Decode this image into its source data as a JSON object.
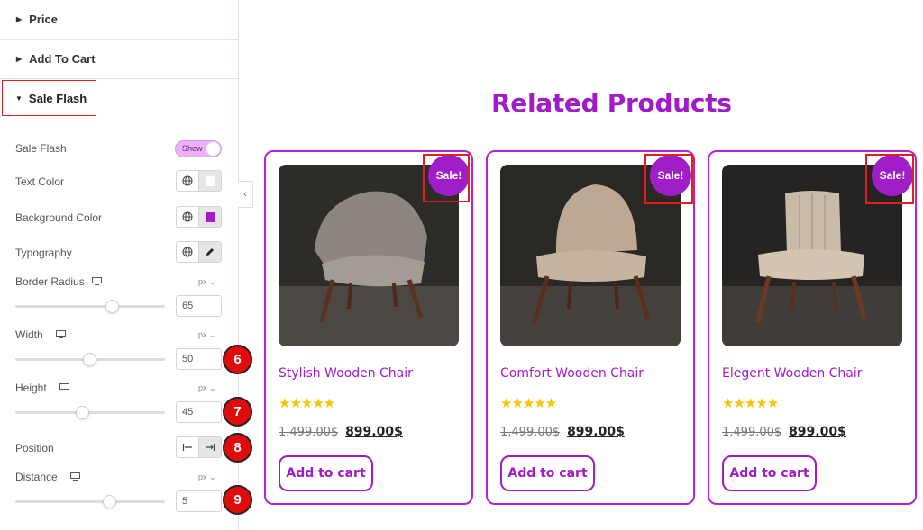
{
  "panel": {
    "sections": {
      "price": "Price",
      "add_to_cart": "Add To Cart",
      "sale_flash": "Sale Flash"
    },
    "controls": {
      "sale_flash_label": "Sale Flash",
      "sale_flash_toggle": "Show",
      "text_color_label": "Text Color",
      "text_color_value": "#ffffff",
      "background_color_label": "Background Color",
      "background_color_value": "#a01ec8",
      "typography_label": "Typography",
      "border_radius_label": "Border Radius",
      "border_radius_unit": "px",
      "border_radius_value": "65",
      "width_label": "Width",
      "width_unit": "px",
      "width_value": "50",
      "height_label": "Height",
      "height_unit": "px",
      "height_value": "45",
      "position_label": "Position",
      "position_options": [
        "left",
        "right"
      ],
      "position_selected": "right",
      "distance_label": "Distance",
      "distance_unit": "px",
      "distance_value": "5"
    },
    "markers": [
      "6",
      "7",
      "8",
      "9"
    ]
  },
  "main": {
    "heading": "Related Products",
    "products": [
      {
        "name": "Stylish Wooden Chair",
        "badge": "Sale!",
        "stars": "★★★★★",
        "old_price": "1,499.00$",
        "new_price": "899.00$",
        "button": "Add to cart"
      },
      {
        "name": "Comfort Wooden Chair",
        "badge": "Sale!",
        "stars": "★★★★★",
        "old_price": "1,499.00$",
        "new_price": "899.00$",
        "button": "Add to cart"
      },
      {
        "name": "Elegent Wooden Chair",
        "badge": "Sale!",
        "stars": "★★★★★",
        "old_price": "1,499.00$",
        "new_price": "899.00$",
        "button": "Add to cart"
      }
    ]
  },
  "colors": {
    "accent": "#a21bc9",
    "badge": "#a01ec8",
    "highlight": "#e02020",
    "stars": "#f6c400"
  }
}
